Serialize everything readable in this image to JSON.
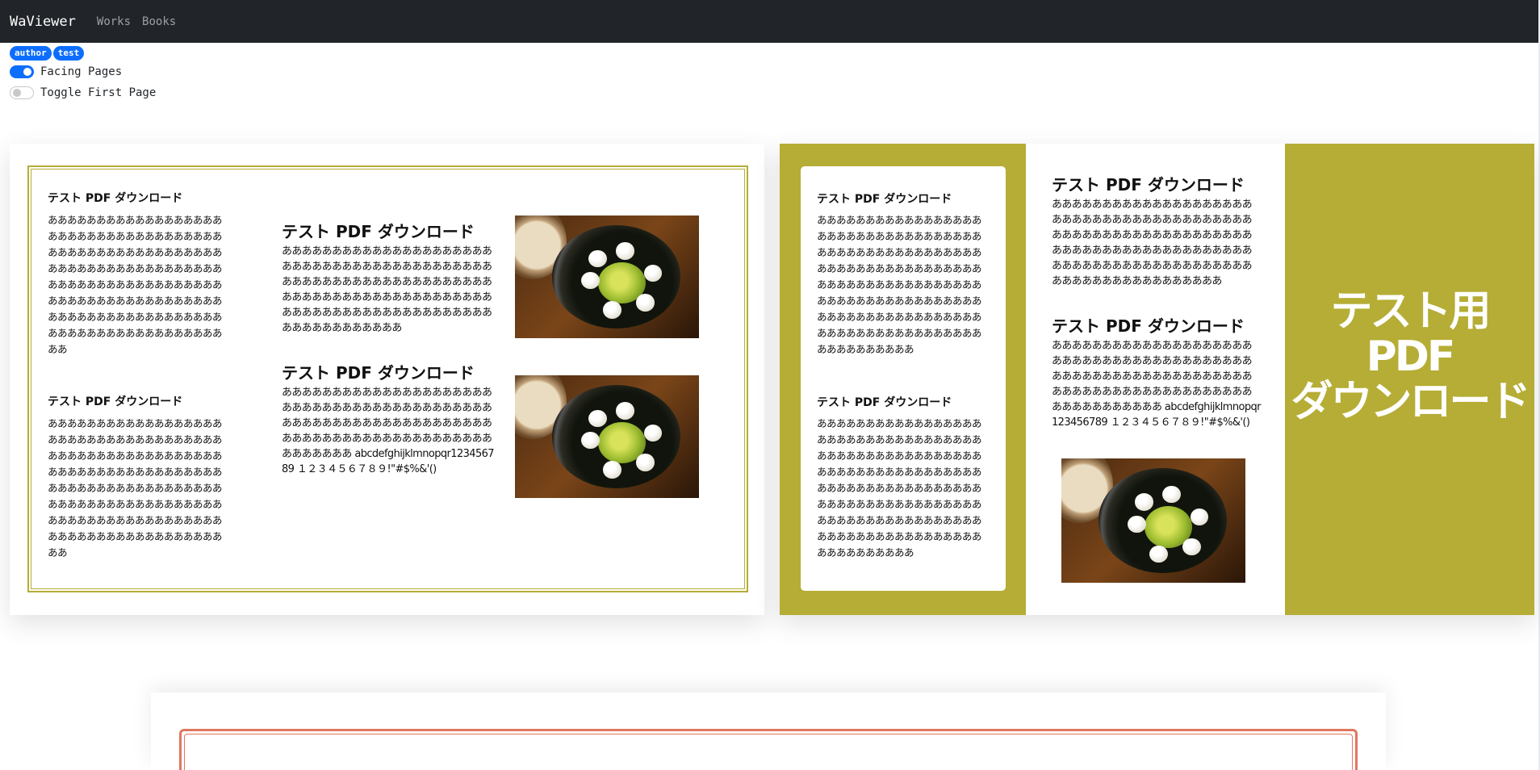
{
  "nav": {
    "brand": "WaViewer",
    "links": [
      "Works",
      "Books"
    ]
  },
  "tags": [
    "author",
    "test"
  ],
  "toggles": {
    "facing_pages": {
      "label": "Facing Pages",
      "on": true
    },
    "first_page": {
      "label": "Toggle First Page",
      "on": false
    }
  },
  "pdf": {
    "heading": "テスト PDF ダウンロード",
    "body_a_long": "ああああああああああああああああああああああああああああああああああああああああああああああああああああああああああああああああああああああああああああああああああああああああああああああああああああああああああああああああああああああああああああああああああああああああああああああああああ",
    "body_medium": "あああああああああああああああああああああああああああああああああああああああああああああああああああああああああああああああああああああああああああああああああああああああああああああああああああああああああああああああああああああ",
    "body_mixed": "あああああああああああああああああああああああああああああああああああああああああああああああああああああああああああああああああああああああああああああああああああああああああああ abcdefghijklmnopqr123456789 １２３４５６７８９!\"#$%&'()",
    "cover_title_lines": [
      "テスト用",
      "PDF",
      "ダウンロード"
    ]
  },
  "colors": {
    "accent": "#0d6efd",
    "olive": "#b5ad35",
    "navbar": "#212529",
    "next_page_border": "#e0775f"
  }
}
